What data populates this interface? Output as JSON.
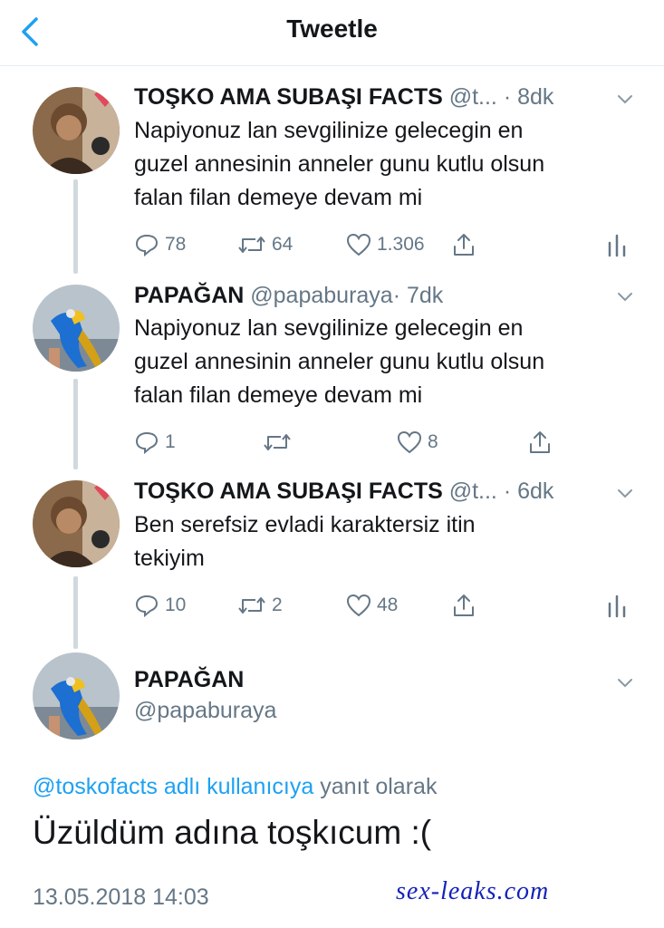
{
  "header": {
    "back_icon": "chevron-left-icon",
    "title": "Tweetle"
  },
  "colors": {
    "accent": "#1da1f2",
    "muted": "#657786",
    "text": "#14171a",
    "watermark": "#1522b8"
  },
  "tweets": [
    {
      "name": "TOŞKO AMA SUBAŞI FACTS",
      "handle": "@t...",
      "time": "· 8dk",
      "text_lines": [
        "Napiyonuz lan sevgilinize gelecegin en",
        "guzel annesinin anneler gunu kutlu olsun",
        "falan filan demeye devam mi"
      ],
      "replies": "78",
      "retweets": "64",
      "likes": "1.306"
    },
    {
      "name": "PAPAĞAN",
      "handle": "@papaburaya",
      "time": "· 7dk",
      "text_lines": [
        "Napiyonuz lan sevgilinize gelecegin en",
        "guzel annesinin anneler gunu kutlu olsun",
        "falan filan demeye devam mi"
      ],
      "replies": "1",
      "retweets": "",
      "likes": "8"
    },
    {
      "name": "TOŞKO AMA SUBAŞI FACTS",
      "handle": "@t...",
      "time": "· 6dk",
      "text_lines": [
        "Ben serefsiz evladi karaktersiz itin",
        "tekiyim"
      ],
      "replies": "10",
      "retweets": "2",
      "likes": "48"
    }
  ],
  "main_tweet": {
    "name": "PAPAĞAN",
    "handle": "@papaburaya",
    "reply_to_link": "@toskofacts adlı kullanıcıya",
    "reply_to_rest": "yanıt olarak",
    "text": "Üzüldüm adına toşkıcum :(",
    "timestamp": "13.05.2018 14:03"
  },
  "watermark": "sex-leaks.com"
}
